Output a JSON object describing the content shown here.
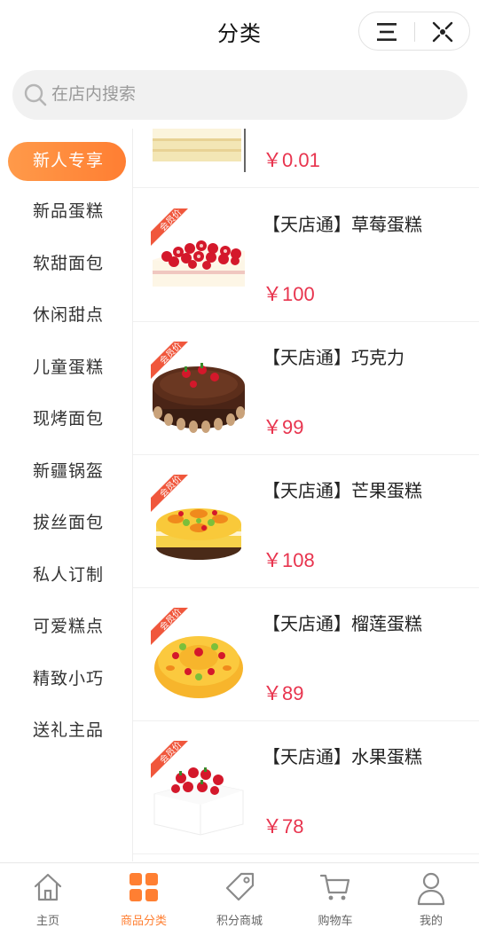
{
  "header": {
    "title": "分类"
  },
  "search": {
    "placeholder": "在店内搜索"
  },
  "sidebar": {
    "items": [
      {
        "label": "新人专享",
        "active": true
      },
      {
        "label": "新品蛋糕"
      },
      {
        "label": "软甜面包"
      },
      {
        "label": "休闲甜点"
      },
      {
        "label": "儿童蛋糕"
      },
      {
        "label": "现烤面包"
      },
      {
        "label": "新疆锅盔"
      },
      {
        "label": "拔丝面包"
      },
      {
        "label": "私人订制"
      },
      {
        "label": "可爱糕点"
      },
      {
        "label": "精致小巧"
      },
      {
        "label": "送礼主品"
      }
    ]
  },
  "products": [
    {
      "name": "",
      "price": "￥0.01",
      "image": "square-cream-cake"
    },
    {
      "name": "【天店通】草莓蛋糕",
      "price": "￥100",
      "badge": "会员价",
      "image": "strawberry-square-cake"
    },
    {
      "name": "【天店通】巧克力",
      "price": "￥99",
      "badge": "会员价",
      "image": "chocolate-cake"
    },
    {
      "name": "【天店通】芒果蛋糕",
      "price": "￥108",
      "badge": "会员价",
      "image": "mango-cake"
    },
    {
      "name": "【天店通】榴莲蛋糕",
      "price": "￥89",
      "badge": "会员价",
      "image": "durian-cake"
    },
    {
      "name": "【天店通】水果蛋糕",
      "price": "￥78",
      "badge": "会员价",
      "image": "fruit-cake"
    }
  ],
  "tabbar": {
    "items": [
      {
        "label": "主页",
        "icon": "home-icon"
      },
      {
        "label": "商品分类",
        "icon": "grid-icon",
        "active": true
      },
      {
        "label": "积分商城",
        "icon": "tag-icon"
      },
      {
        "label": "购物车",
        "icon": "cart-icon"
      },
      {
        "label": "我的",
        "icon": "user-icon"
      }
    ]
  },
  "colors": {
    "accent": "#ff7f32",
    "price": "#e8344e",
    "badge": "#f0573c"
  }
}
